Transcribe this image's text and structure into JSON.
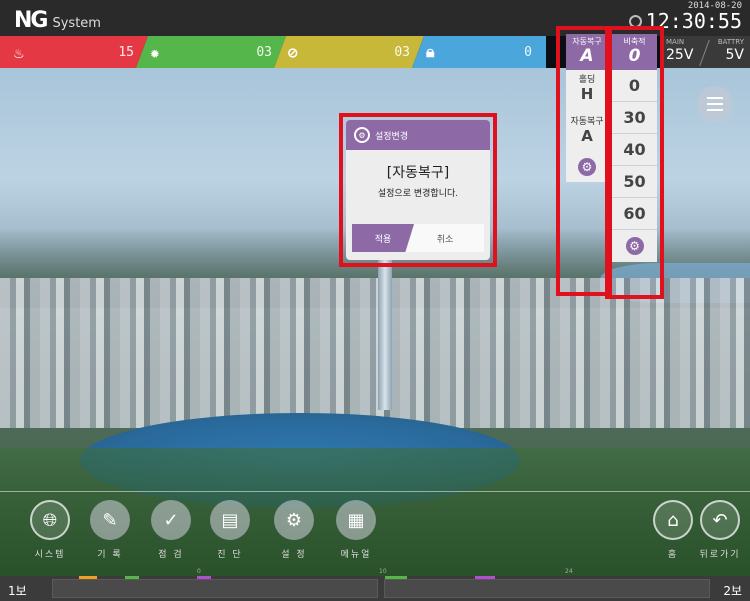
{
  "header": {
    "logo": "NG",
    "system": "System",
    "date": "2014-08-20",
    "time": "12:30:55"
  },
  "status": {
    "fire_count": "15",
    "fault_count": "03",
    "disabled_count": "03",
    "lock_count": "0",
    "power": {
      "main_label": "MAIN",
      "main_value": "25V",
      "battery_label": "BATTRY",
      "battery_value": "5V"
    }
  },
  "mode_panel": {
    "header_label": "자동복구",
    "header_value": "A",
    "items": [
      {
        "label": "홀딩",
        "value": "H"
      },
      {
        "label": "자동복구",
        "value": "A"
      }
    ]
  },
  "speed_panel": {
    "header_label": "비축적",
    "header_value": "0",
    "items": [
      "0",
      "30",
      "40",
      "50",
      "60"
    ]
  },
  "dialog": {
    "title": "설정변경",
    "heading": "[자동복구]",
    "message": "설정으로 변경합니다.",
    "apply_label": "적용",
    "cancel_label": "취소"
  },
  "nav": {
    "items": [
      {
        "label": "시스템",
        "icon": "globe-icon"
      },
      {
        "label": "기 록",
        "icon": "pencil-icon"
      },
      {
        "label": "점 검",
        "icon": "inspect-icon"
      },
      {
        "label": "진 단",
        "icon": "clipboard-icon"
      },
      {
        "label": "설 정",
        "icon": "gear-icon"
      },
      {
        "label": "메뉴얼",
        "icon": "manual-icon"
      }
    ],
    "home_label": "홈",
    "back_label": "뒤로가기"
  },
  "timeline": {
    "left_label": "1보",
    "right_label": "2보",
    "ticks": [
      "0",
      "10",
      "24"
    ]
  },
  "colors": {
    "fire": "#e53845",
    "fault": "#55b64b",
    "disabled": "#c7b83a",
    "lock": "#4aa6db",
    "accent": "#8d6aa6",
    "highlight": "#e0101c"
  }
}
